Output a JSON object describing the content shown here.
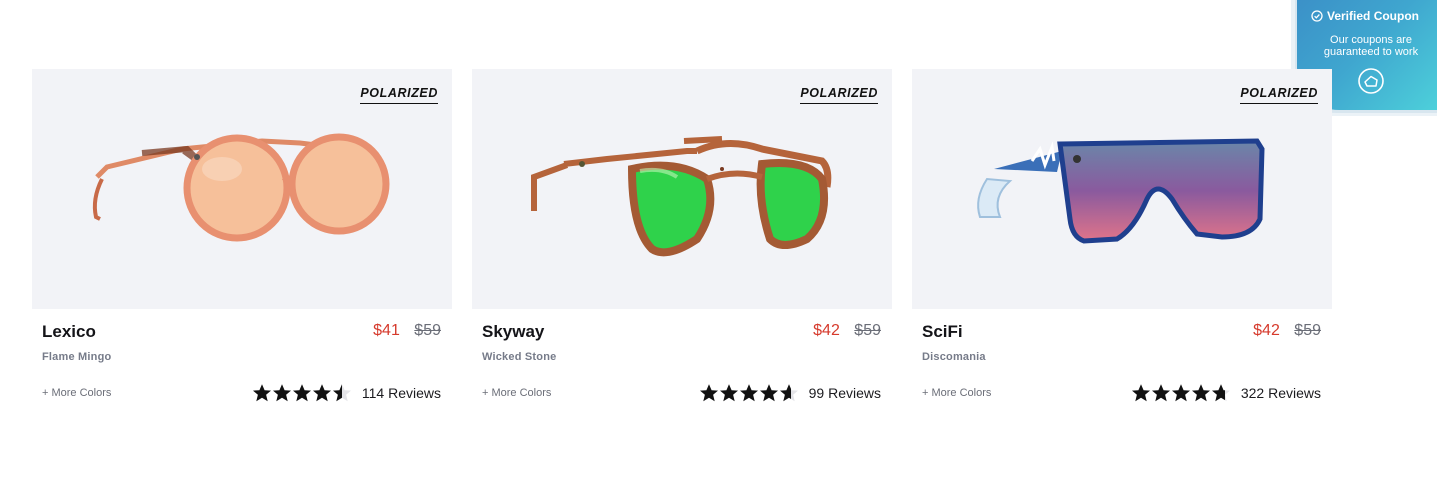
{
  "coupon": {
    "title": "Verified Coupon",
    "text": "Our coupons are guaranteed to work",
    "gradient_start": "#3b8fc7",
    "gradient_end": "#4fd6dc"
  },
  "products": [
    {
      "badge": "POLARIZED",
      "name": "Lexico",
      "sale_price": "$41",
      "original_price": "$59",
      "color_name": "Flame Mingo",
      "more_colors": "+ More Colors",
      "rating": 4.5,
      "reviews": "114 Reviews",
      "frame_color": "#e89070",
      "lens_color": "#f6c09a"
    },
    {
      "badge": "POLARIZED",
      "name": "Skyway",
      "sale_price": "$42",
      "original_price": "$59",
      "color_name": "Wicked Stone",
      "more_colors": "+ More Colors",
      "rating": 4.6,
      "reviews": "99 Reviews",
      "frame_color": "#b5643b",
      "lens_color": "#2fd24b"
    },
    {
      "badge": "POLARIZED",
      "name": "SciFi",
      "sale_price": "$42",
      "original_price": "$59",
      "color_name": "Discomania",
      "more_colors": "+ More Colors",
      "rating": 4.7,
      "reviews": "322 Reviews",
      "frame_color": "#1f3f8e",
      "lens_color": "#8a5a9e"
    }
  ],
  "colors": {
    "sale_price": "#d63a2c",
    "card_background": "#f2f3f7"
  }
}
